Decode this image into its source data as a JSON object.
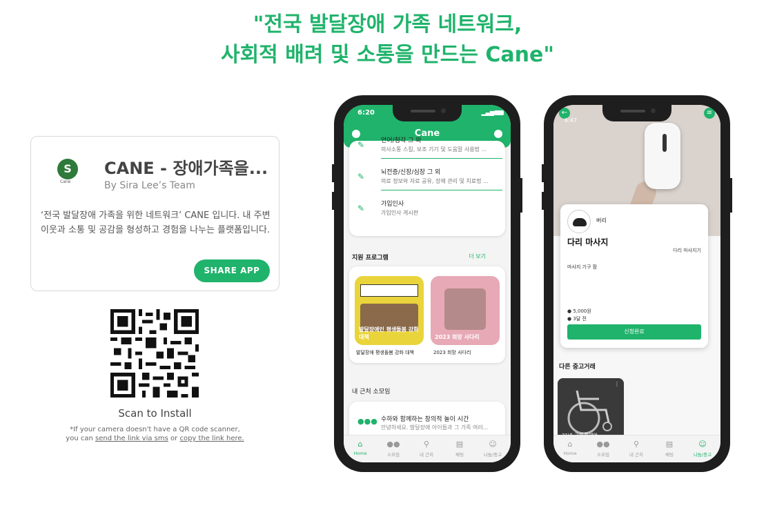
{
  "headline": {
    "line1": "\"전국 발달장애 가족 네트워크,",
    "line2": "사회적 배려 및 소통을 만드는 Cane\""
  },
  "app_card": {
    "logo_text": "Cane",
    "title": "CANE - 장애가족을...",
    "author": "By Sira Lee’s Team",
    "description": "‘전국 발달장애 가족을 위한 네트워크’ CANE 입니다. 내 주변 이웃과 소통 및 공감을 형성하고 경험을 나누는 플랫폼입니다.",
    "share_label": "SHARE APP"
  },
  "qr": {
    "scan_label": "Scan to Install",
    "note_prefix": "*If your camera doesn't have a QR code scanner,",
    "note_you_can": "you can",
    "note_link1": "send the link via sms",
    "note_or": "or",
    "note_link2": "copy the link here."
  },
  "phone1": {
    "time": "6:20",
    "app_title": "Cane",
    "categories": [
      {
        "title": "언어/청각 그 외",
        "subtitle": "의사소통 스킬, 보조 기기 및 도움말 사용법 ..."
      },
      {
        "title": "뇌전증/신장/심장 그 외",
        "subtitle": "의료 정보와 자료 공유, 장애 관리 및 치료법 ..."
      },
      {
        "title": "가입인사",
        "subtitle": "가입인사 게시판"
      }
    ],
    "support_title": "지원 프로그램",
    "support_more": "더 보기",
    "programs": [
      {
        "caption": "발달장애인 평생돌봄 강화 대책",
        "label": "발달장애 평생돌봄 강화 대책",
        "color": "#e9d43b"
      },
      {
        "caption": "2023 희망 사다리",
        "label": "2023 희망 사다리",
        "color": "#e7a9b6"
      }
    ],
    "nearby_title": "내 근처 소모임",
    "nearby": {
      "title": "수하와 함께하는 창의적 놀이 시간",
      "subtitle": "안녕하세요. 발달장애 아이들과 그 가족 여러..."
    },
    "tabs": [
      "Home",
      "소모임",
      "내 근처",
      "채팅",
      "나눔/중고"
    ]
  },
  "phone2": {
    "time": "6:47",
    "user": "버리",
    "title": "다리 마사지",
    "category": "다리 마사지기",
    "description": "마사지 기구 팜",
    "price": "5,000원",
    "ago": "3달 전",
    "apply_label": "신청완료",
    "used_title": "다른 중고거래",
    "used_item_caption": "21년 구매 휠체어",
    "tabs": [
      "Home",
      "소모임",
      "내 근처",
      "채팅",
      "나눔/중고"
    ]
  },
  "colors": {
    "brand": "#1fb36b",
    "phone_frame": "#1e1e1e"
  },
  "icons": [
    "share-icon",
    "qr-code",
    "pencil-icon",
    "people-icon",
    "home-icon",
    "location-icon",
    "chat-icon",
    "person-icon",
    "back-arrow-icon",
    "menu-icon"
  ]
}
